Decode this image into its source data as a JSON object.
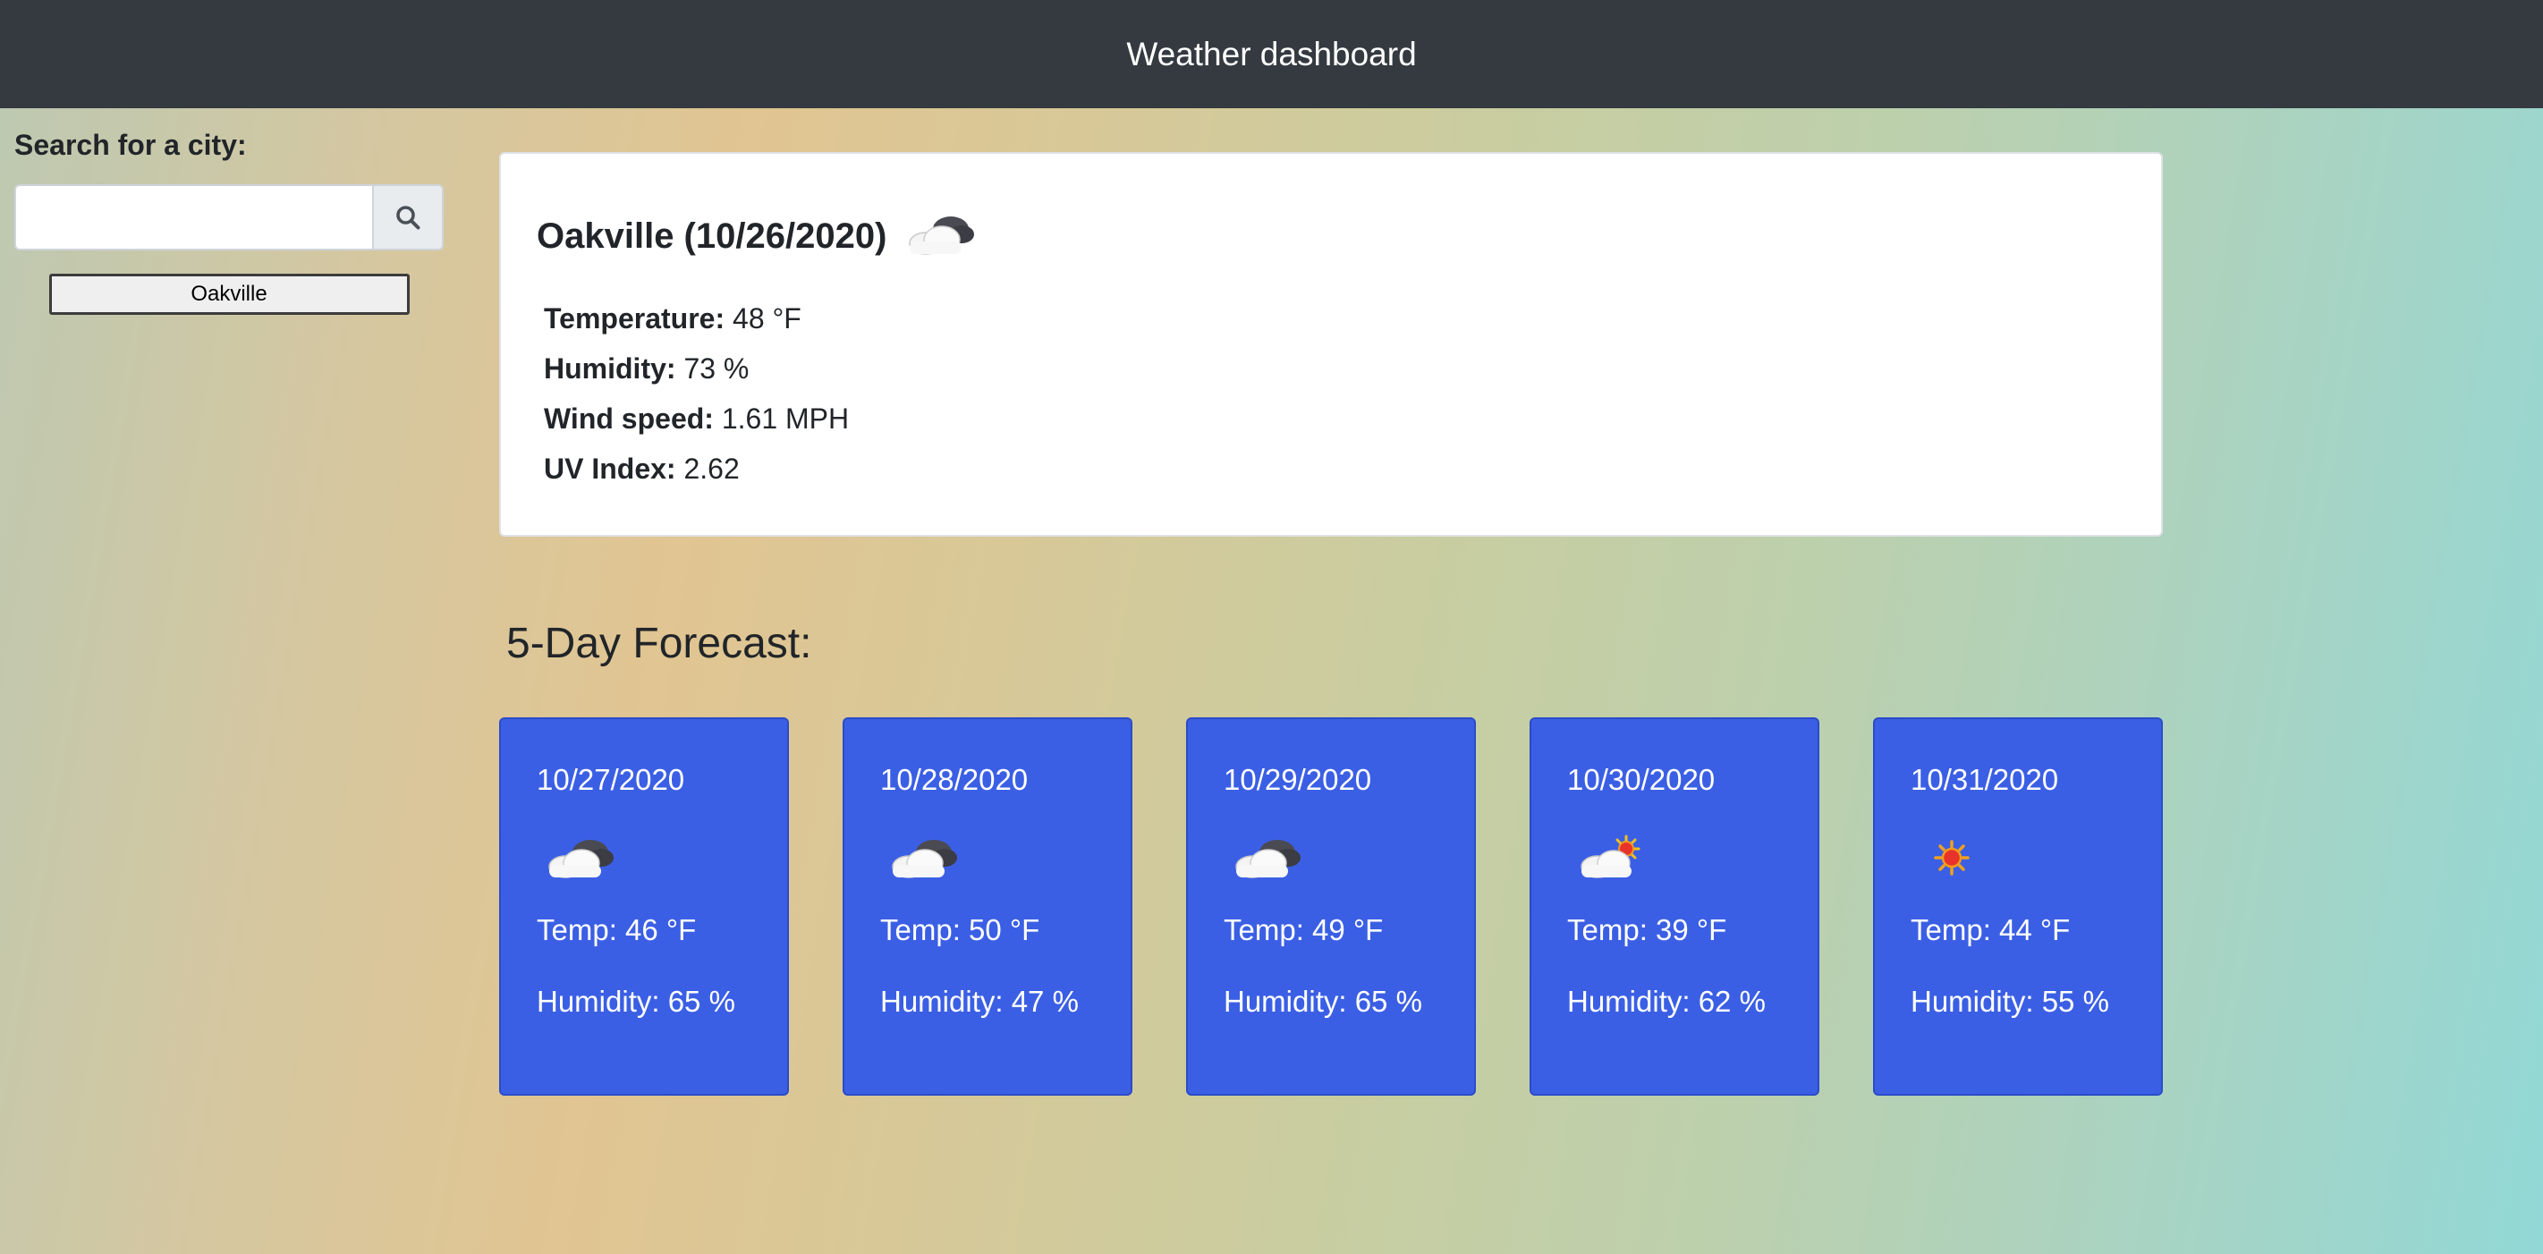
{
  "header": {
    "title": "Weather dashboard"
  },
  "sidebar": {
    "search_label": "Search for a city:",
    "search_value": "",
    "search_placeholder": "",
    "search_button_icon": "search-icon",
    "history": [
      "Oakville"
    ]
  },
  "current": {
    "title": "Oakville (10/26/2020)",
    "icon": "cloud-moon-icon",
    "temperature_label": "Temperature:",
    "temperature_value": "48 °F",
    "humidity_label": "Humidity:",
    "humidity_value": "73 %",
    "wind_label": "Wind speed:",
    "wind_value": "1.61 MPH",
    "uv_label": "UV Index:",
    "uv_value": "2.62"
  },
  "forecast": {
    "title": "5-Day Forecast:",
    "days": [
      {
        "date": "10/27/2020",
        "icon": "cloud-moon-icon",
        "temp": "Temp: 46 °F",
        "humidity": "Humidity: 65 %"
      },
      {
        "date": "10/28/2020",
        "icon": "cloud-moon-icon",
        "temp": "Temp: 50 °F",
        "humidity": "Humidity: 47 %"
      },
      {
        "date": "10/29/2020",
        "icon": "cloud-moon-icon",
        "temp": "Temp: 49 °F",
        "humidity": "Humidity: 65 %"
      },
      {
        "date": "10/30/2020",
        "icon": "cloud-sun-icon",
        "temp": "Temp: 39 °F",
        "humidity": "Humidity: 62 %"
      },
      {
        "date": "10/31/2020",
        "icon": "sun-icon",
        "temp": "Temp: 44 °F",
        "humidity": "Humidity: 55 %"
      }
    ]
  },
  "colors": {
    "topbar": "#343a40",
    "forecast_card": "#3b5fe4",
    "card_bg": "#ffffff"
  }
}
